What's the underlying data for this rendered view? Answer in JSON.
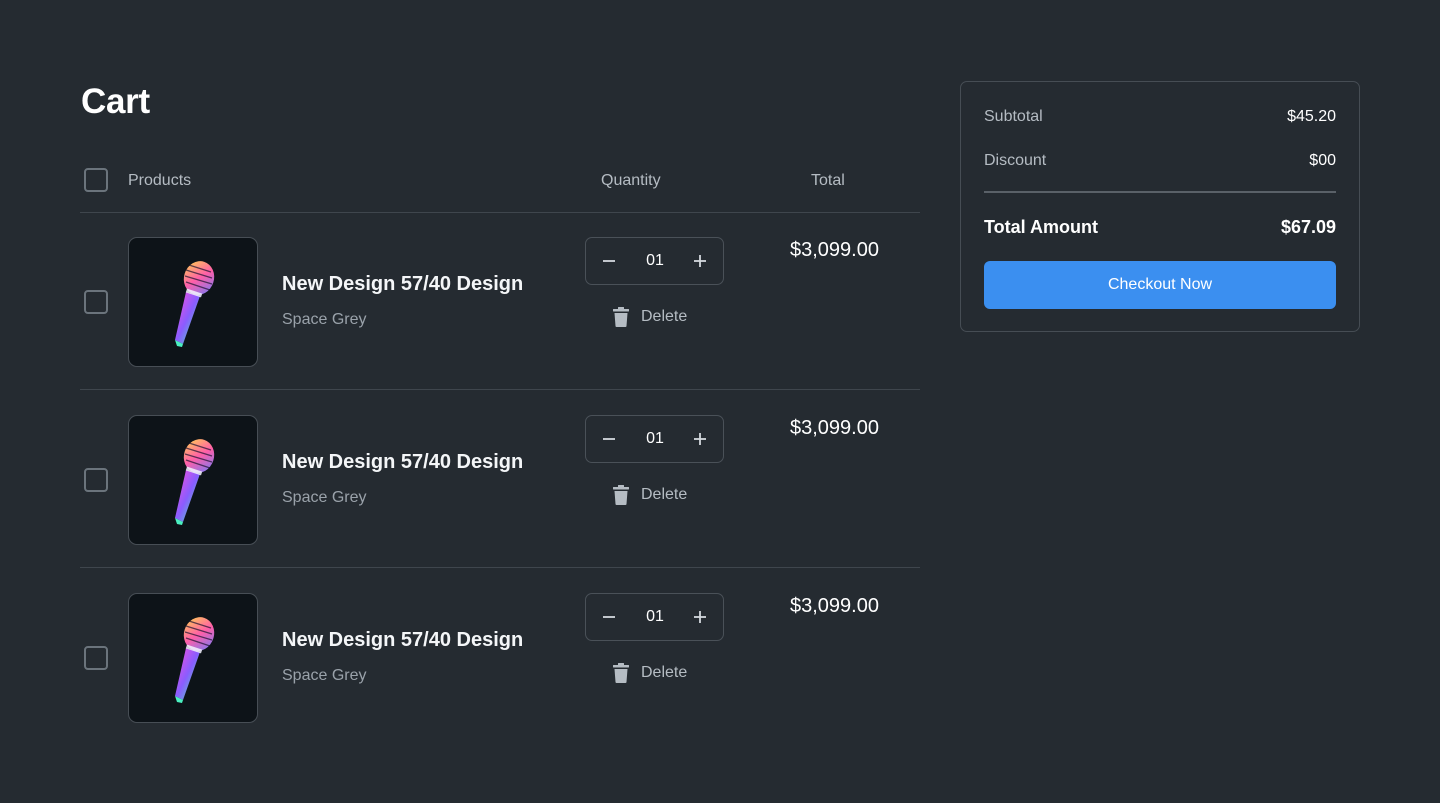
{
  "cart": {
    "title": "Cart",
    "columns": {
      "products": "Products",
      "quantity": "Quantity",
      "total": "Total"
    },
    "delete_label": "Delete",
    "items": [
      {
        "name": "New Design 57/40 Design",
        "variant": "Space Grey",
        "quantity": "01",
        "total": "$3,099.00",
        "image": "microphone-image"
      },
      {
        "name": "New Design 57/40 Design",
        "variant": "Space Grey",
        "quantity": "01",
        "total": "$3,099.00",
        "image": "microphone-image"
      },
      {
        "name": "New Design 57/40 Design",
        "variant": "Space Grey",
        "quantity": "01",
        "total": "$3,099.00",
        "image": "microphone-image"
      }
    ]
  },
  "summary": {
    "subtotal_label": "Subtotal",
    "subtotal_value": "$45.20",
    "discount_label": "Discount",
    "discount_value": "$00",
    "total_label": "Total Amount",
    "total_value": "$67.09",
    "checkout_label": "Checkout Now"
  },
  "colors": {
    "background": "#252b31",
    "accent": "#3b8ff0",
    "border": "#464d54",
    "muted_text": "#b5bcc3"
  }
}
